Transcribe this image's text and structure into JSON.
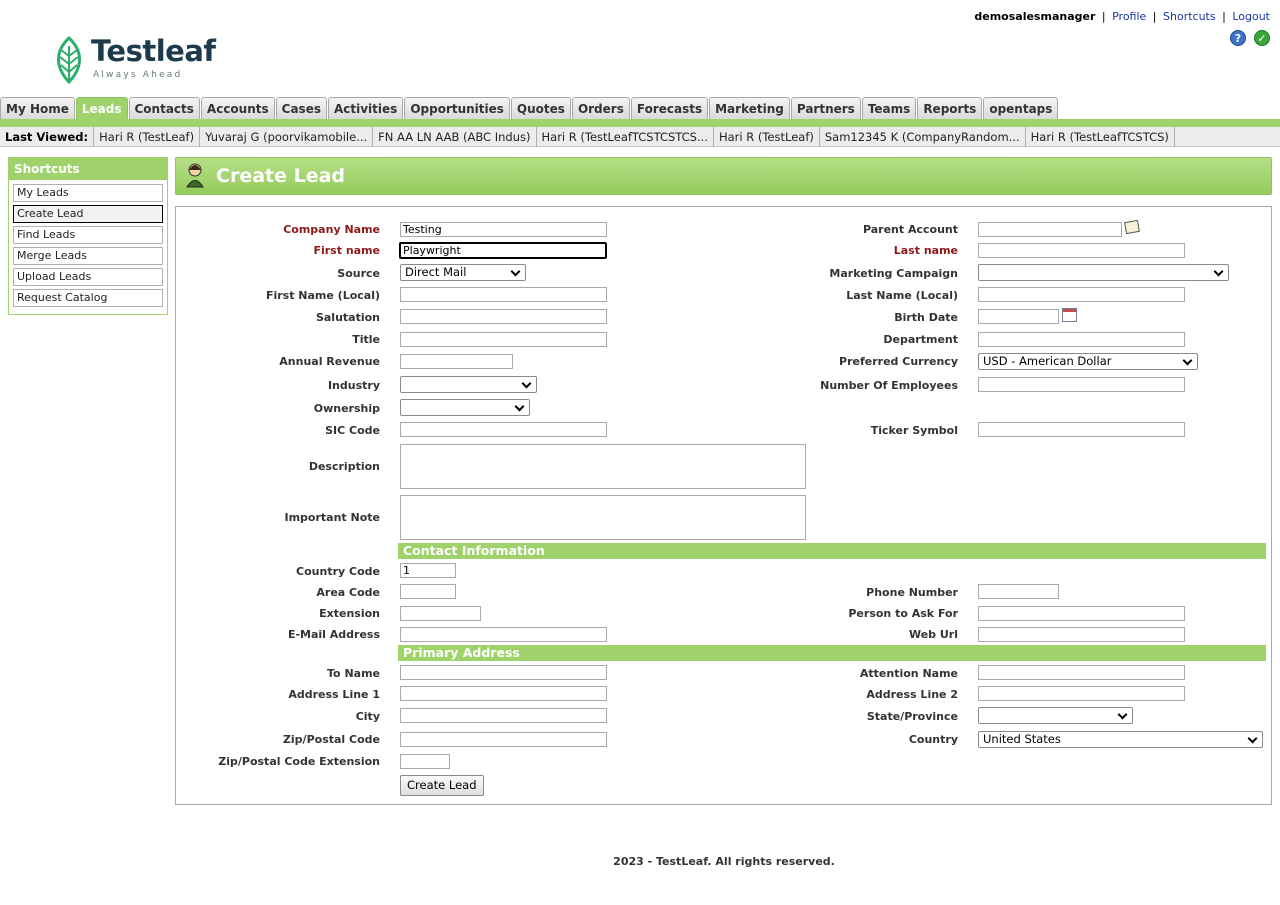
{
  "header": {
    "brand": "Testleaf",
    "tagline": "Always Ahead",
    "user": "demosalesmanager",
    "links": [
      "Profile",
      "Shortcuts",
      "Logout"
    ],
    "sep": "|"
  },
  "tabs": [
    "My Home",
    "Leads",
    "Contacts",
    "Accounts",
    "Cases",
    "Activities",
    "Opportunities",
    "Quotes",
    "Orders",
    "Forecasts",
    "Marketing",
    "Partners",
    "Teams",
    "Reports",
    "opentaps"
  ],
  "last_viewed": {
    "label": "Last Viewed:",
    "items": [
      "Hari R (TestLeaf)",
      "Yuvaraj G (poorvikamobile...",
      "FN AA LN AAB (ABC Indus)",
      "Hari R (TestLeafTCSTCSTCS...",
      "Hari R (TestLeaf)",
      "Sam12345 K (CompanyRandom...",
      "Hari R (TestLeafTCSTCS)"
    ]
  },
  "sidebar": {
    "title": "Shortcuts",
    "items": [
      "My Leads",
      "Create Lead",
      "Find Leads",
      "Merge Leads",
      "Upload Leads",
      "Request Catalog"
    ]
  },
  "page": {
    "title": "Create Lead"
  },
  "form": {
    "company_name": {
      "label": "Company Name",
      "value": "Testing"
    },
    "first_name": {
      "label": "First name",
      "value": "Playwright"
    },
    "source": {
      "label": "Source",
      "value": "Direct Mail"
    },
    "first_name_local": {
      "label": "First Name (Local)",
      "value": ""
    },
    "salutation": {
      "label": "Salutation",
      "value": ""
    },
    "title": {
      "label": "Title",
      "value": ""
    },
    "annual_revenue": {
      "label": "Annual Revenue",
      "value": ""
    },
    "industry": {
      "label": "Industry",
      "value": ""
    },
    "ownership": {
      "label": "Ownership",
      "value": ""
    },
    "sic_code": {
      "label": "SIC Code",
      "value": ""
    },
    "description": {
      "label": "Description",
      "value": ""
    },
    "important_note": {
      "label": "Important Note",
      "value": ""
    },
    "parent_account": {
      "label": "Parent Account",
      "value": ""
    },
    "last_name": {
      "label": "Last name",
      "value": ""
    },
    "marketing_campaign": {
      "label": "Marketing Campaign",
      "value": ""
    },
    "last_name_local": {
      "label": "Last Name (Local)",
      "value": ""
    },
    "birth_date": {
      "label": "Birth Date",
      "value": ""
    },
    "department": {
      "label": "Department",
      "value": ""
    },
    "preferred_currency": {
      "label": "Preferred Currency",
      "value": "USD - American Dollar"
    },
    "number_of_employees": {
      "label": "Number Of Employees",
      "value": ""
    },
    "ticker_symbol": {
      "label": "Ticker Symbol",
      "value": ""
    }
  },
  "contact": {
    "section_title": "Contact Information",
    "country_code": {
      "label": "Country Code",
      "value": "1"
    },
    "area_code": {
      "label": "Area Code",
      "value": ""
    },
    "extension": {
      "label": "Extension",
      "value": ""
    },
    "email": {
      "label": "E-Mail Address",
      "value": ""
    },
    "phone": {
      "label": "Phone Number",
      "value": ""
    },
    "person_to_ask": {
      "label": "Person to Ask For",
      "value": ""
    },
    "web_url": {
      "label": "Web Url",
      "value": ""
    }
  },
  "address": {
    "section_title": "Primary Address",
    "to_name": {
      "label": "To Name",
      "value": ""
    },
    "line1": {
      "label": "Address Line 1",
      "value": ""
    },
    "city": {
      "label": "City",
      "value": ""
    },
    "zip": {
      "label": "Zip/Postal Code",
      "value": ""
    },
    "zip_ext": {
      "label": "Zip/Postal Code Extension",
      "value": ""
    },
    "attention": {
      "label": "Attention Name",
      "value": ""
    },
    "line2": {
      "label": "Address Line 2",
      "value": ""
    },
    "state": {
      "label": "State/Province",
      "value": ""
    },
    "country": {
      "label": "Country",
      "value": "United States"
    }
  },
  "submit_label": "Create Lead",
  "footer": "2023 - TestLeaf. All rights reserved.",
  "colors": {
    "accent": "#9fd26a",
    "required": "#8b1a1a",
    "link": "#1a37a8"
  },
  "icons": {
    "help": "help-icon",
    "ok": "check-icon",
    "calendar": "calendar-icon",
    "lookup": "lookup-icon"
  }
}
